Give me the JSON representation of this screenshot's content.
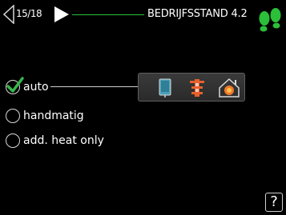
{
  "header": {
    "page_indicator": "15/18",
    "title": "BEDRIJFSSTAND 4.2"
  },
  "options": [
    {
      "label": "auto",
      "selected": true
    },
    {
      "label": "handmatig",
      "selected": false
    },
    {
      "label": "add. heat only",
      "selected": false
    }
  ],
  "help": {
    "label": "?"
  },
  "icons": {
    "back": "triangle-left-outline-icon",
    "forward": "triangle-right-filled-icon",
    "brand": "green-footprints-icon",
    "panel": [
      "compressor-unit-icon",
      "heat-radiator-icon",
      "addition-heater-house-icon"
    ]
  },
  "colors": {
    "background": "#000000",
    "accent_green": "#2bbf3a",
    "check_green": "#39b54a",
    "text": "#ffffff"
  }
}
